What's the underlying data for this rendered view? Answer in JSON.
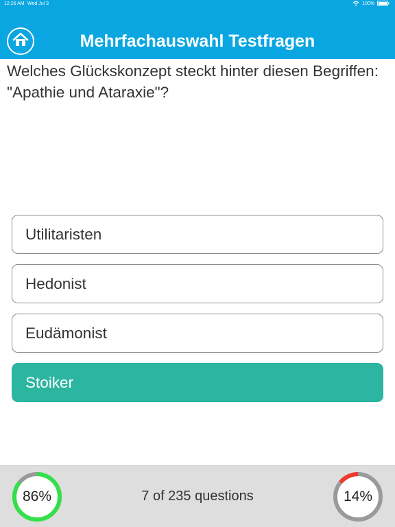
{
  "status": {
    "time": "12:26 AM",
    "date": "Wed Jul 3",
    "battery": "100%",
    "icons": [
      "wifi-icon",
      "battery-icon"
    ]
  },
  "header": {
    "title": "Mehrfachauswahl Testfragen",
    "home_icon": "home-icon",
    "background_color": "#0aa6e2"
  },
  "question": {
    "text": "Welches Glückskonzept steckt hinter diesen Begriffen: \"Apathie und Ataraxie\"?"
  },
  "answers": [
    {
      "label": "Utilitaristen",
      "selected": false
    },
    {
      "label": "Hedonist",
      "selected": false
    },
    {
      "label": "Eudämonist",
      "selected": false
    },
    {
      "label": "Stoiker",
      "selected": true
    }
  ],
  "footer": {
    "correct_percent": "86%",
    "correct_fraction": 0.86,
    "correct_color": "#33e04a",
    "wrong_percent": "14%",
    "wrong_fraction": 0.14,
    "wrong_color": "#f03a2e",
    "ring_track_color": "#9a9a9a",
    "counter": "7 of 235 questions"
  },
  "colors": {
    "selected_answer": "#2cb5a0"
  }
}
